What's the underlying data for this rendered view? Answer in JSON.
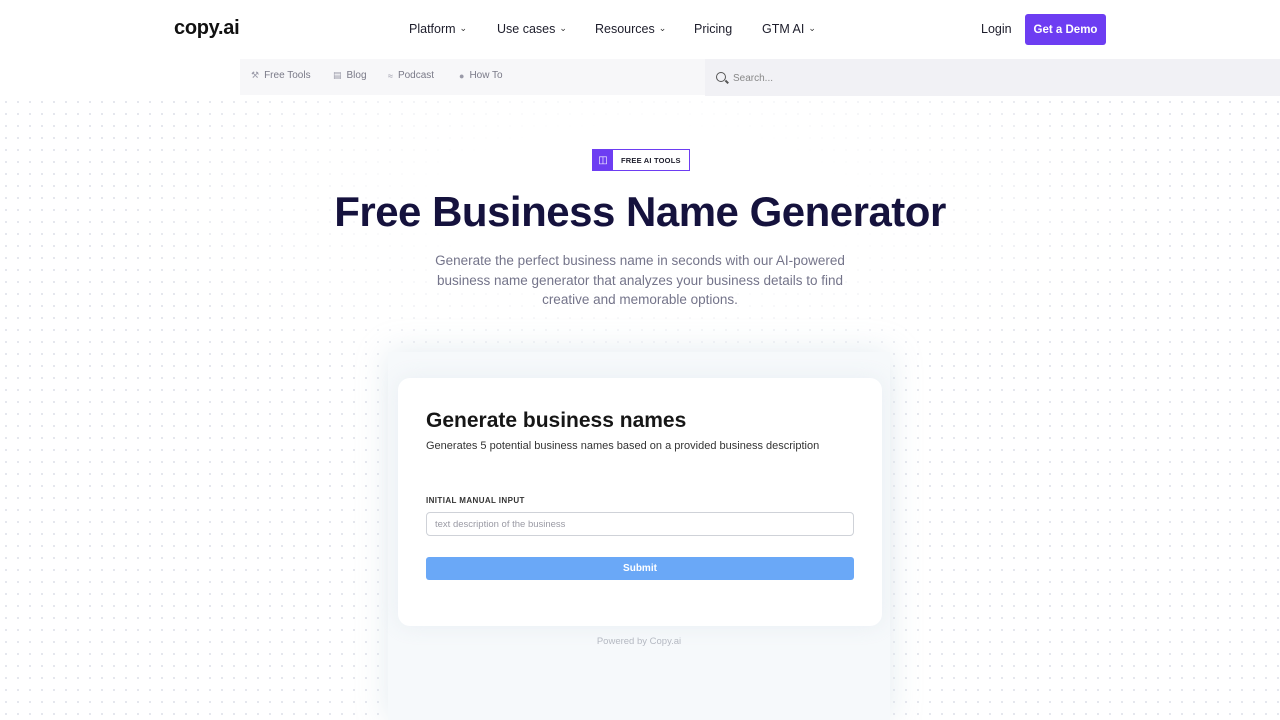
{
  "brand": {
    "logo": "copy.ai",
    "accent": "#6d3df2"
  },
  "nav": {
    "items": [
      {
        "label": "Platform",
        "dropdown": true
      },
      {
        "label": "Use cases",
        "dropdown": true
      },
      {
        "label": "Resources",
        "dropdown": true
      },
      {
        "label": "Pricing",
        "dropdown": false
      },
      {
        "label": "GTM AI",
        "dropdown": true
      }
    ],
    "login": "Login",
    "demo": "Get a Demo"
  },
  "subnav": {
    "items": [
      {
        "label": "Free Tools",
        "icon": "tools-icon"
      },
      {
        "label": "Blog",
        "icon": "blog-icon"
      },
      {
        "label": "Podcast",
        "icon": "podcast-icon"
      },
      {
        "label": "How To",
        "icon": "how-to-icon"
      }
    ],
    "search_placeholder": "Search..."
  },
  "hero": {
    "badge": "FREE AI TOOLS",
    "title": "Free Business Name Generator",
    "subtitle": "Generate the perfect business name in seconds with our AI-powered business name generator that analyzes your business details to find creative and memorable options."
  },
  "tool": {
    "title": "Generate business names",
    "description": "Generates 5 potential business names based on a provided business description",
    "field_label": "INITIAL MANUAL INPUT",
    "field_placeholder": "text description of the business",
    "field_value": "",
    "submit": "Submit",
    "powered_by": "Powered by Copy.ai"
  }
}
